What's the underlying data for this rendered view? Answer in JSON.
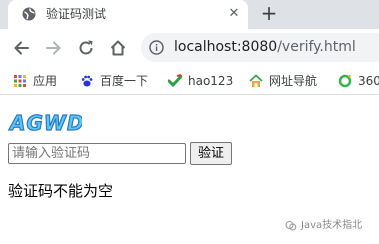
{
  "browser": {
    "tab": {
      "title": "验证码测试",
      "close_glyph": "✕"
    },
    "new_tab_glyph": "+",
    "address": {
      "host": "localhost:8080",
      "path": "/verify.html"
    },
    "nav": {
      "back_icon": "arrow-left",
      "forward_icon": "arrow-right",
      "reload_icon": "reload",
      "home_icon": "home"
    },
    "bookmarks": [
      {
        "label": "应用",
        "icon": "apps-grid"
      },
      {
        "label": "百度一下",
        "icon": "baidu-paw"
      },
      {
        "label": "hao123",
        "icon": "hao123-check"
      },
      {
        "label": "网址导航",
        "icon": "2345-house"
      },
      {
        "label": "360",
        "icon": "360-ring"
      }
    ]
  },
  "page": {
    "captcha_text": "AGWD",
    "input_placeholder": "请输入验证码",
    "input_value": "",
    "submit_label": "验证",
    "message": "验证码不能为空"
  },
  "watermark": {
    "text": "Java技术指北"
  },
  "colors": {
    "tab_strip": "#dee1e6",
    "omnibox": "#f1f3f4",
    "captcha_fill": "#5bc8f0",
    "captcha_outline": "#2a78c8"
  }
}
